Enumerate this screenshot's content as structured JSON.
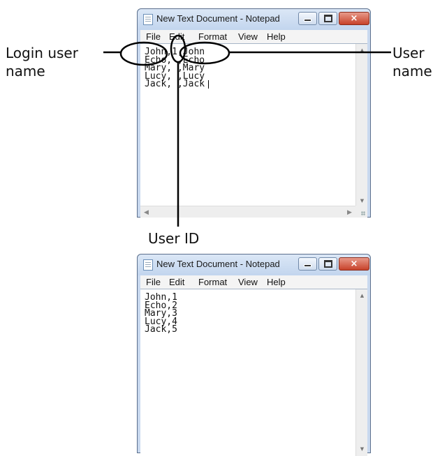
{
  "windows": [
    {
      "title": "New Text Document - Notepad",
      "menu": [
        "File",
        "Edit",
        "Format",
        "View",
        "Help"
      ],
      "lines": [
        "John,1,John",
        "Echo, ,Echo",
        "Mary, ,Mary",
        "Lucy, ,Lucy",
        "Jack, ,Jack"
      ]
    },
    {
      "title": "New Text Document - Notepad",
      "menu": [
        "File",
        "Edit",
        "Format",
        "View",
        "Help"
      ],
      "lines": [
        "John,1",
        "Echo,2",
        "Mary,3",
        "Lucy,4",
        "Jack,5"
      ]
    }
  ],
  "annotations": {
    "login_user_name": [
      "Login user",
      "name"
    ],
    "user_name": [
      "User",
      "name"
    ],
    "user_id": "User ID"
  },
  "icons": {
    "close": "×",
    "scroll_up": "▲",
    "scroll_down": "▼",
    "scroll_left": "◀",
    "scroll_right": "▶"
  },
  "colors": {
    "title_bar": "#c2d5ee",
    "close_button": "#c7422a",
    "menu_bar": "#f4f4f4"
  }
}
